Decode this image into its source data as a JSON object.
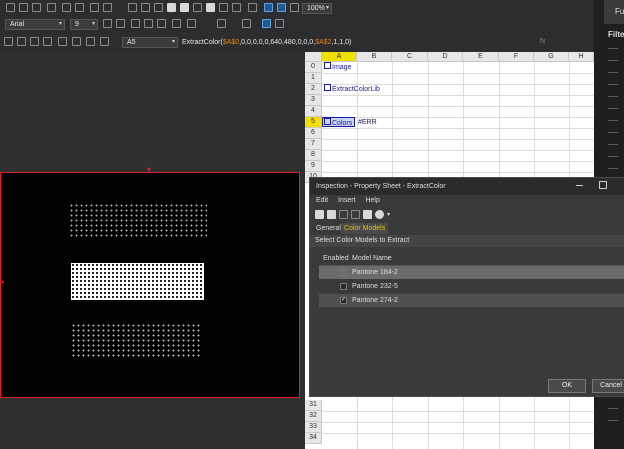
{
  "toolbar": {
    "font_name": "Arial",
    "font_size": "9",
    "zoom": "100%"
  },
  "formula_bar": {
    "cell_ref": "A5",
    "formula_prefix": "ExtractColor(",
    "formula_ref1": "$A$0",
    "formula_mid": ",0,0,0,0,0,640,480,0,0,0,",
    "formula_ref2": "$A$2",
    "formula_suffix": ",1,1,0)",
    "fx": "fx"
  },
  "grid": {
    "columns": [
      "A",
      "B",
      "C",
      "D",
      "E",
      "F",
      "G",
      "H"
    ],
    "rows": [
      "0",
      "1",
      "2",
      "3",
      "4",
      "5",
      "6",
      "7",
      "8",
      "9",
      "10",
      "31",
      "32",
      "33",
      "34"
    ],
    "cells": {
      "a0": "Image",
      "a2": "ExtractColorLib",
      "a5": "Colors",
      "b5": "#ERR"
    }
  },
  "right_panel": {
    "label1": "Fu",
    "label2": "Filte"
  },
  "dialog": {
    "title": "Inspection - Property Sheet - ExtractColor",
    "menu": [
      "Edit",
      "Insert",
      "Help"
    ],
    "tabs": {
      "general": "General",
      "color_models": "Color Models"
    },
    "section_label": "Select Color Models to Extract",
    "headers": {
      "enabled": "Enabled",
      "model_name": "Model Name"
    },
    "rows": [
      {
        "name": "Pantone 184-2",
        "enabled": false
      },
      {
        "name": "Pantone 232-5",
        "enabled": false
      },
      {
        "name": "Pantone 274-2",
        "enabled": true
      }
    ],
    "ok_label": "OK",
    "cancel_label": "Cancel"
  },
  "colors": {
    "accent_yellow": "#f0e000",
    "ref_orange": "#e08020",
    "selected_tab": "#e6c200",
    "canvas_border": "#e02020"
  }
}
